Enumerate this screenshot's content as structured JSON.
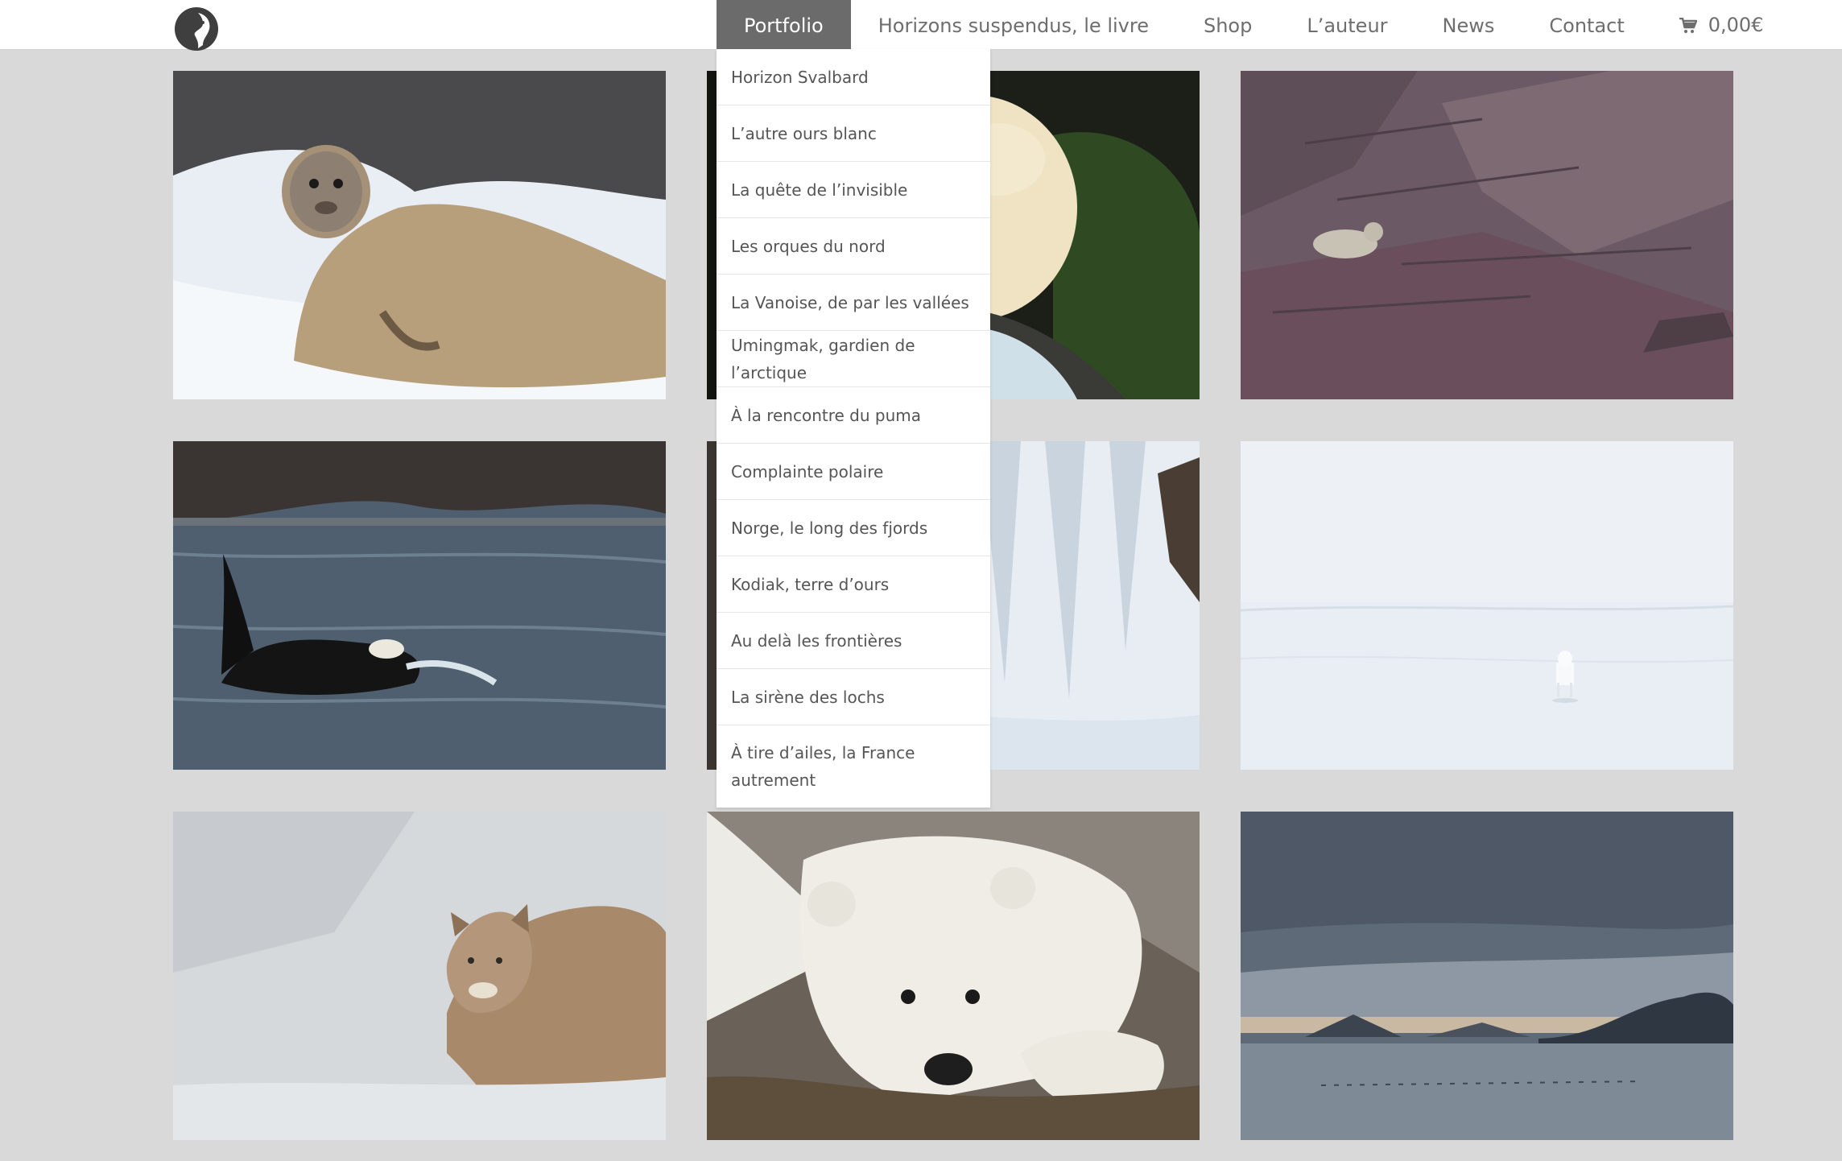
{
  "header": {
    "logo_icon": "logo-icon",
    "nav": [
      {
        "label": "Portfolio",
        "active": true
      },
      {
        "label": "Horizons suspendus, le livre"
      },
      {
        "label": "Shop"
      },
      {
        "label": "L’auteur"
      },
      {
        "label": "News"
      },
      {
        "label": "Contact"
      }
    ],
    "cart": {
      "icon": "cart-icon",
      "total": "0,00€"
    }
  },
  "portfolio_menu": [
    "Horizon Svalbard",
    "L’autre ours blanc",
    "La quête de l’invisible",
    "Les orques du nord",
    "La Vanoise, de par les vallées",
    "Umingmak, gardien de l’arctique",
    "À la rencontre du puma",
    "Complainte polaire",
    "Norge, le long des fjords",
    "Kodiak, terre d’ours",
    "Au delà les frontières",
    "La sirène des lochs",
    "À tire d’ailes, la France autrement"
  ],
  "gallery": [
    {
      "subject": "bearded-seal-on-ice-photo"
    },
    {
      "subject": "white-bear-by-stream-photo"
    },
    {
      "subject": "snow-leopard-on-rocks-photo"
    },
    {
      "subject": "orca-in-sea-photo"
    },
    {
      "subject": "frozen-waterfall-photo"
    },
    {
      "subject": "arctic-wolf-on-snow-photo"
    },
    {
      "subject": "puma-in-snow-photo"
    },
    {
      "subject": "polar-bear-resting-photo"
    },
    {
      "subject": "fjord-at-dusk-photo"
    }
  ],
  "colors": {
    "nav_active_bg": "#6b6b6b",
    "page_bg": "#d9d9d9"
  }
}
